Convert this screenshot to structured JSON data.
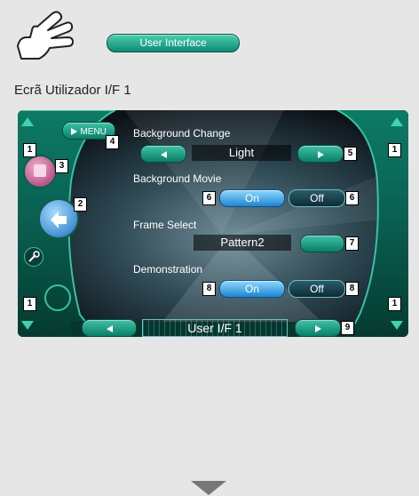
{
  "header": {
    "pill_label": "User Interface"
  },
  "section_title": "Ecrã Utilizador I/F 1",
  "screen": {
    "menu_label": "MENU",
    "background_change": {
      "label": "Background Change",
      "value": "Light"
    },
    "background_movie": {
      "label": "Background Movie",
      "on": "On",
      "off": "Off"
    },
    "frame_select": {
      "label": "Frame Select",
      "value": "Pattern2"
    },
    "demonstration": {
      "label": "Demonstration",
      "on": "On",
      "off": "Off"
    },
    "footer_title": "User I/F 1"
  },
  "callouts": {
    "c1": "1",
    "c2": "2",
    "c3": "3",
    "c4": "4",
    "c5": "5",
    "c6": "6",
    "c7": "7",
    "c8": "8",
    "c9": "9"
  },
  "icons": [
    "hand-icon",
    "arrow-up-icon",
    "arrow-down-icon",
    "left-arrow-icon",
    "right-arrow-icon",
    "return-icon",
    "source-icon",
    "wrench-icon",
    "down-arrow-icon"
  ],
  "colors": {
    "accent": "#1aa58a",
    "selected": "#3aa9e8",
    "screen_bg": "#0b0d12"
  }
}
